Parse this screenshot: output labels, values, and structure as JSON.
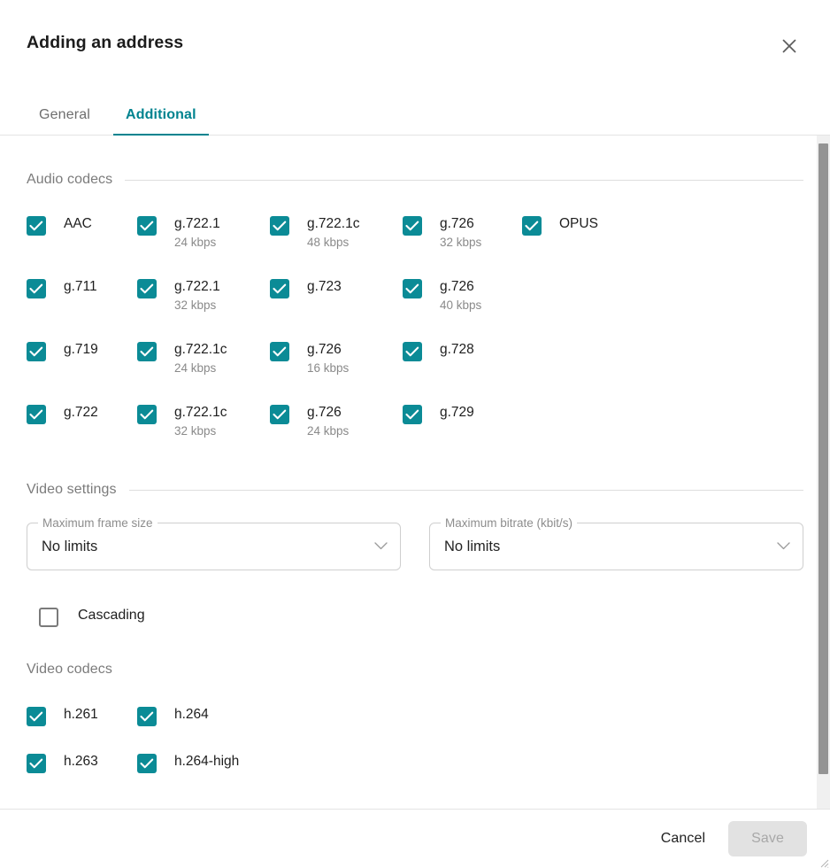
{
  "dialog": {
    "title": "Adding an address",
    "close_icon": "close-icon"
  },
  "tabs": [
    {
      "label": "General",
      "active": false
    },
    {
      "label": "Additional",
      "active": true
    }
  ],
  "sections": {
    "audio_codecs": {
      "title": "Audio codecs",
      "has_rule": true,
      "rows": [
        [
          {
            "name": "AAC",
            "sub": "",
            "checked": true
          },
          {
            "name": "g.722.1",
            "sub": "24 kbps",
            "checked": true
          },
          {
            "name": "g.722.1c",
            "sub": "48 kbps",
            "checked": true
          },
          {
            "name": "g.726",
            "sub": "32 kbps",
            "checked": true
          },
          {
            "name": "OPUS",
            "sub": "",
            "checked": true
          }
        ],
        [
          {
            "name": "g.711",
            "sub": "",
            "checked": true
          },
          {
            "name": "g.722.1",
            "sub": "32 kbps",
            "checked": true
          },
          {
            "name": "g.723",
            "sub": "",
            "checked": true
          },
          {
            "name": "g.726",
            "sub": "40 kbps",
            "checked": true
          }
        ],
        [
          {
            "name": "g.719",
            "sub": "",
            "checked": true
          },
          {
            "name": "g.722.1c",
            "sub": "24 kbps",
            "checked": true
          },
          {
            "name": "g.726",
            "sub": "16 kbps",
            "checked": true
          },
          {
            "name": "g.728",
            "sub": "",
            "checked": true
          }
        ],
        [
          {
            "name": "g.722",
            "sub": "",
            "checked": true
          },
          {
            "name": "g.722.1c",
            "sub": "32 kbps",
            "checked": true
          },
          {
            "name": "g.726",
            "sub": "24 kbps",
            "checked": true
          },
          {
            "name": "g.729",
            "sub": "",
            "checked": true
          }
        ]
      ]
    },
    "video_settings": {
      "title": "Video settings",
      "has_rule": true,
      "fields": [
        {
          "label": "Maximum frame size",
          "value": "No limits",
          "icon": "chevron-down-icon"
        },
        {
          "label": "Maximum bitrate (kbit/s)",
          "value": "No limits",
          "icon": "chevron-down-icon"
        }
      ],
      "cascading": {
        "name": "Cascading",
        "checked": false
      }
    },
    "video_codecs": {
      "title": "Video codecs",
      "has_rule": false,
      "rows": [
        [
          {
            "name": "h.261",
            "sub": "",
            "checked": true
          },
          {
            "name": "h.264",
            "sub": "",
            "checked": true
          }
        ],
        [
          {
            "name": "h.263",
            "sub": "",
            "checked": true
          },
          {
            "name": "h.264-high",
            "sub": "",
            "checked": true
          }
        ]
      ]
    }
  },
  "footer": {
    "cancel_label": "Cancel",
    "save_label": "Save"
  },
  "colors": {
    "accent": "#00838f",
    "checkbox": "#0b8b96",
    "text": "#1e1e1e",
    "muted": "#8a8a8a"
  }
}
